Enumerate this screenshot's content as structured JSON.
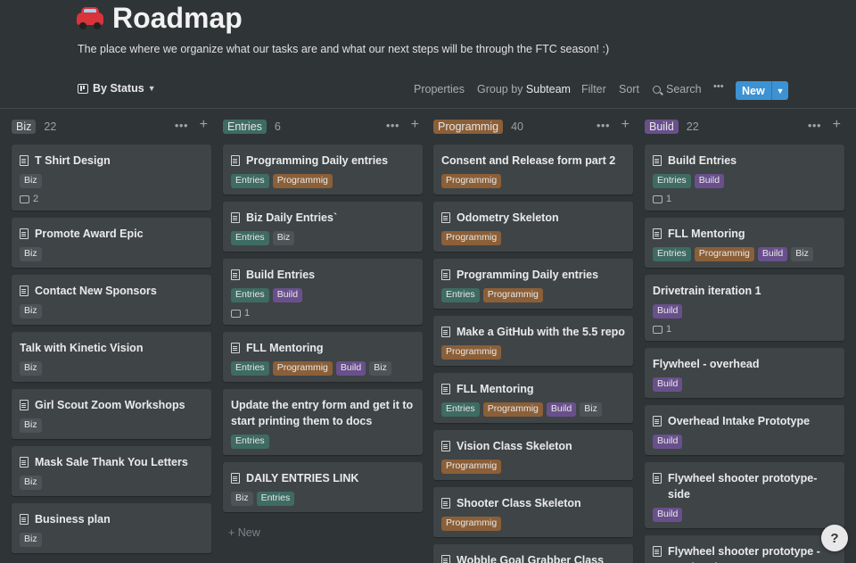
{
  "page": {
    "emoji": "car-icon",
    "title": "Roadmap",
    "subtitle": "The place where we organize what our tasks are and what our next steps will be through the FTC season! :)"
  },
  "toolbar": {
    "view_label": "By Status",
    "properties": "Properties",
    "group_by_prefix": "Group by",
    "group_by_value": "Subteam",
    "filter": "Filter",
    "sort": "Sort",
    "search": "Search",
    "more": "•••",
    "new_label": "New"
  },
  "colors": {
    "background": "#2f3437",
    "card": "#3f4447",
    "accent": "#3c92d2",
    "biz": "#4d5356",
    "entries": "#3e6b62",
    "programmig": "#8b5f38",
    "build": "#69508c"
  },
  "columns": [
    {
      "name": "Biz",
      "count": "22",
      "tag_class": "t-biz",
      "cards": [
        {
          "title": "T Shirt Design",
          "icon": true,
          "tags": [
            "Biz"
          ],
          "comments": "2"
        },
        {
          "title": "Promote Award Epic",
          "icon": true,
          "tags": [
            "Biz"
          ]
        },
        {
          "title": "Contact New Sponsors",
          "icon": true,
          "tags": [
            "Biz"
          ]
        },
        {
          "title": "Talk with Kinetic Vision",
          "icon": false,
          "tags": [
            "Biz"
          ]
        },
        {
          "title": "Girl Scout Zoom Workshops",
          "icon": true,
          "tags": [
            "Biz"
          ]
        },
        {
          "title": "Mask Sale Thank You Letters",
          "icon": true,
          "tags": [
            "Biz"
          ]
        },
        {
          "title": "Business plan",
          "icon": true,
          "tags": [
            "Biz"
          ]
        }
      ]
    },
    {
      "name": "Entries",
      "count": "6",
      "tag_class": "t-entries",
      "cards": [
        {
          "title": "Programming Daily entries",
          "icon": true,
          "tags": [
            "Entries",
            "Programmig"
          ]
        },
        {
          "title": "Biz Daily Entries`",
          "icon": true,
          "tags": [
            "Entries",
            "Biz"
          ]
        },
        {
          "title": "Build Entries",
          "icon": true,
          "tags": [
            "Entries",
            "Build"
          ],
          "comments": "1"
        },
        {
          "title": "FLL Mentoring",
          "icon": true,
          "tags": [
            "Entries",
            "Programmig",
            "Build",
            "Biz"
          ]
        },
        {
          "title": "Update the entry form and get it to start printing them to docs",
          "icon": false,
          "tags": [
            "Entries"
          ]
        },
        {
          "title": "DAILY ENTRIES LINK",
          "icon": true,
          "tags": [
            "Biz",
            "Entries"
          ]
        }
      ],
      "new_label": "+ New"
    },
    {
      "name": "Programmig",
      "count": "40",
      "tag_class": "t-prog",
      "cards": [
        {
          "title": "Consent and Release form part 2",
          "icon": false,
          "tags": [
            "Programmig"
          ]
        },
        {
          "title": "Odometry Skeleton",
          "icon": true,
          "tags": [
            "Programmig"
          ]
        },
        {
          "title": "Programming Daily entries",
          "icon": true,
          "tags": [
            "Entries",
            "Programmig"
          ]
        },
        {
          "title": "Make a GitHub with the 5.5 repo",
          "icon": true,
          "tags": [
            "Programmig"
          ]
        },
        {
          "title": "FLL Mentoring",
          "icon": true,
          "tags": [
            "Entries",
            "Programmig",
            "Build",
            "Biz"
          ]
        },
        {
          "title": "Vision Class Skeleton",
          "icon": true,
          "tags": [
            "Programmig"
          ]
        },
        {
          "title": "Shooter Class Skeleton",
          "icon": true,
          "tags": [
            "Programmig"
          ]
        },
        {
          "title": "Wobble Goal Grabber Class",
          "icon": true,
          "tags": []
        }
      ]
    },
    {
      "name": "Build",
      "count": "22",
      "tag_class": "t-build",
      "cards": [
        {
          "title": "Build Entries",
          "icon": true,
          "tags": [
            "Entries",
            "Build"
          ],
          "comments": "1"
        },
        {
          "title": "FLL Mentoring",
          "icon": true,
          "tags": [
            "Entries",
            "Programmig",
            "Build",
            "Biz"
          ]
        },
        {
          "title": "Drivetrain iteration 1",
          "icon": false,
          "tags": [
            "Build"
          ],
          "comments": "1"
        },
        {
          "title": "Flywheel - overhead",
          "icon": false,
          "tags": [
            "Build"
          ]
        },
        {
          "title": "Overhead Intake Prototype",
          "icon": true,
          "tags": [
            "Build"
          ]
        },
        {
          "title": "Flywheel shooter prototype- side",
          "icon": true,
          "tags": [
            "Build"
          ]
        },
        {
          "title": "Flywheel shooter prototype - overhead",
          "icon": true,
          "tags": []
        }
      ]
    }
  ],
  "help": "?"
}
